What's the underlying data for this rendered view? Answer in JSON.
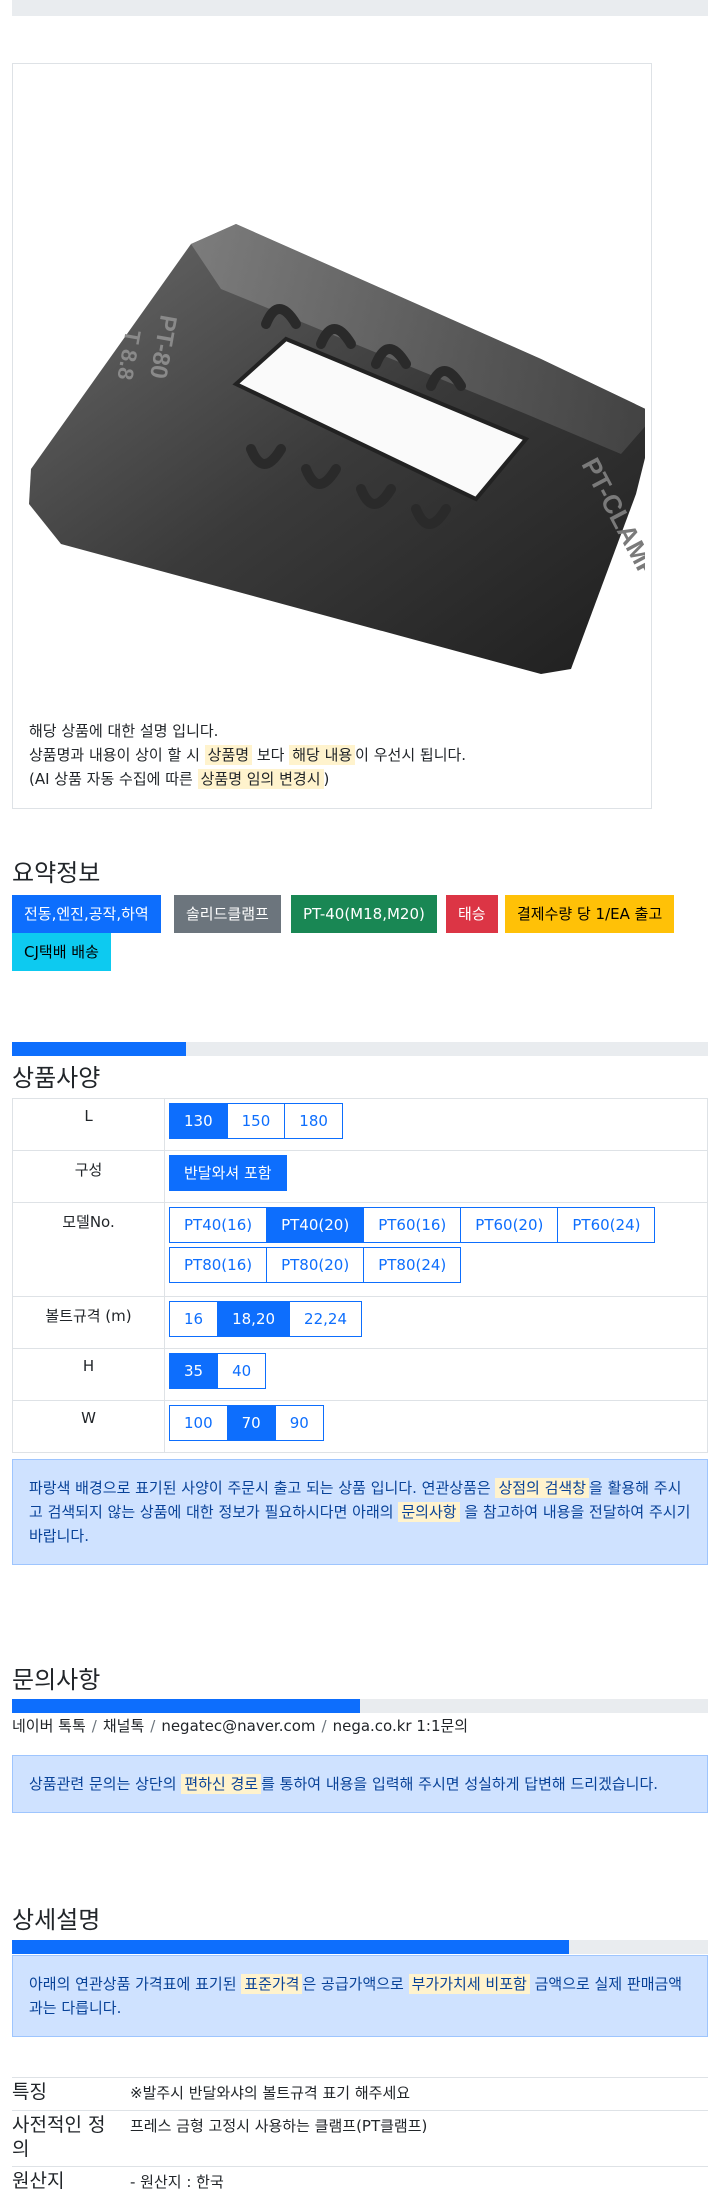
{
  "product": {
    "image_alt": "PT-CLAMP",
    "engraving_front": "PT-CLAMP",
    "engraving_side": "PT-80",
    "engraving_side2": "T 8.8",
    "desc_line1": "해당 상품에 대한 설명 입니다.",
    "desc_line2_a": "상품명과 내용이 상이 할 시 ",
    "desc_line2_hl1": "상품명",
    "desc_line2_b": " 보다 ",
    "desc_line2_hl2": "해당 내용",
    "desc_line2_c": "이 우선시 됩니다.",
    "desc_line3_a": "(AI 상품 자동 수집에 따른 ",
    "desc_line3_hl": "상품명 임의 변경시",
    "desc_line3_b": ")"
  },
  "summary": {
    "title": "요약정보",
    "badges": [
      {
        "label": "전동,엔진,공작,하역",
        "color": "#0d6efd",
        "text": "#ffffff"
      },
      {
        "label": "솔리드클램프",
        "color": "#6c757d",
        "text": "#ffffff"
      },
      {
        "label": "PT-40(M18,M20)",
        "color": "#198754",
        "text": "#ffffff"
      },
      {
        "label": "태승",
        "color": "#dc3545",
        "text": "#ffffff"
      },
      {
        "label": "결제수량 당 1/EA 출고",
        "color": "#ffc107",
        "text": "#000000"
      },
      {
        "label": "CJ택배 배송",
        "color": "#0dcaf0",
        "text": "#000000"
      }
    ]
  },
  "spec": {
    "title": "상품사양",
    "progress": 0.25,
    "rows": [
      {
        "label": "L",
        "options": [
          {
            "v": "130",
            "on": true
          },
          {
            "v": "150",
            "on": false
          },
          {
            "v": "180",
            "on": false
          }
        ]
      },
      {
        "label": "구성",
        "options": [
          {
            "v": "반달와셔 포함",
            "on": true
          }
        ]
      },
      {
        "label": "모델No.",
        "options": [
          {
            "v": "PT40(16)",
            "on": false
          },
          {
            "v": "PT40(20)",
            "on": true
          },
          {
            "v": "PT60(16)",
            "on": false
          },
          {
            "v": "PT60(20)",
            "on": false
          },
          {
            "v": "PT60(24)",
            "on": false
          },
          {
            "v": "PT80(16)",
            "on": false
          },
          {
            "v": "PT80(20)",
            "on": false
          },
          {
            "v": "PT80(24)",
            "on": false
          }
        ]
      },
      {
        "label": "볼트규격 (m)",
        "options": [
          {
            "v": "16",
            "on": false
          },
          {
            "v": "18,20",
            "on": true
          },
          {
            "v": "22,24",
            "on": false
          }
        ]
      },
      {
        "label": "H",
        "options": [
          {
            "v": "35",
            "on": true
          },
          {
            "v": "40",
            "on": false
          }
        ]
      },
      {
        "label": "W",
        "options": [
          {
            "v": "100",
            "on": false
          },
          {
            "v": "70",
            "on": true
          },
          {
            "v": "90",
            "on": false
          }
        ]
      }
    ],
    "note_a": "파랑색 배경으로 표기된 사양이 주문시 출고 되는 상품 입니다. 연관상품은 ",
    "note_hl1": "상점의 검색창",
    "note_b": "을 활용해 주시고 검색되지 않는 상품에 대한 정보가 필요하시다면 아래의 ",
    "note_hl2": "문의사항",
    "note_c": " 을 참고하여 내용을 전달하여 주시기 바랍니다."
  },
  "inquiry": {
    "title": "문의사항",
    "progress": 0.5,
    "channels": [
      "네이버 톡톡",
      "채널톡",
      "negatec@naver.com",
      "nega.co.kr 1:1문의"
    ],
    "sep": "/",
    "note_a": "상품관련 문의는 상단의 ",
    "note_hl": "편하신 경로",
    "note_b": "를 통하여 내용을 입력해 주시면 성실하게 답변해 드리겠습니다."
  },
  "detail": {
    "title": "상세설명",
    "progress": 0.8,
    "note_a": "아래의 연관상품 가격표에 표기된 ",
    "note_hl1": "표준가격",
    "note_b": "은 공급가액으로 ",
    "note_hl2": "부가가치세 비포함",
    "note_c": " 금액으로 실제 판매금액과는 다릅니다.",
    "features": [
      {
        "k": "특징",
        "v": "※발주시 반달와샤의 볼트규격 표기 해주세요"
      },
      {
        "k": "사전적인 정의",
        "v": "프레스 금형 고정시 사용하는 클램프(PT클램프)"
      },
      {
        "k": "원산지",
        "v": "- 원산지 : 한국"
      }
    ]
  }
}
